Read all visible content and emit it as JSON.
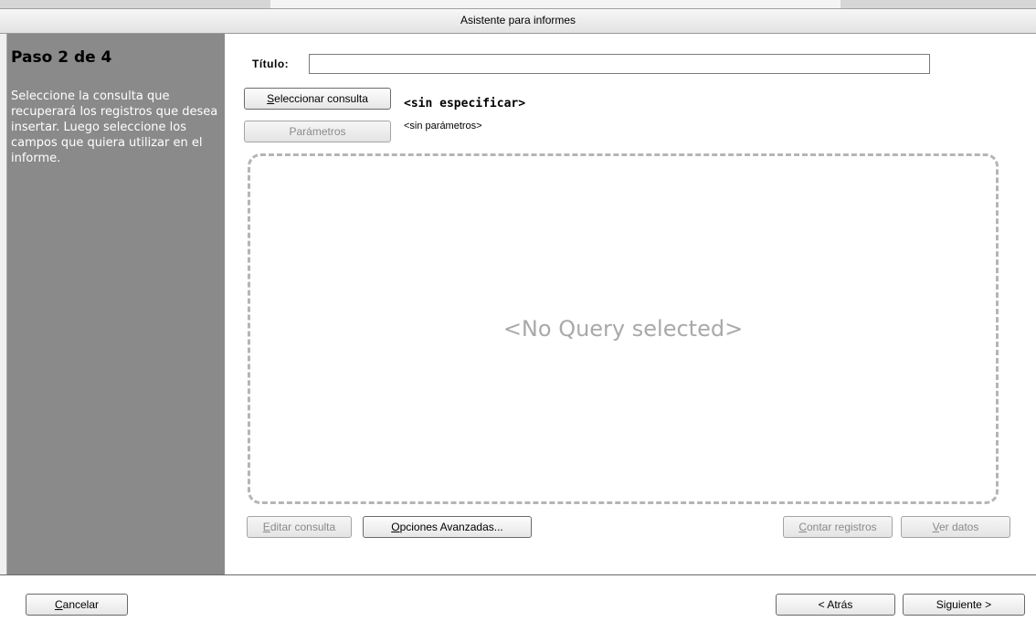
{
  "window": {
    "title": "Asistente para informes"
  },
  "sidebar": {
    "step": "Paso 2 de 4",
    "description": "Seleccione la consulta que recuperará los registros que desea insertar. Luego seleccione los campos que quiera utilizar en el informe."
  },
  "form": {
    "title_label": "Título:",
    "title_value": "",
    "select_query_button": {
      "mnemonic": "S",
      "rest": "eleccionar consulta"
    },
    "query_status": "<sin especificar>",
    "parameters_button": "Parámetros",
    "parameters_status": "<sin parámetros>",
    "query_placeholder": "<No Query selected>",
    "edit_query_button": {
      "mnemonic": "E",
      "rest": "ditar consulta"
    },
    "advanced_options_button": {
      "mnemonic": "O",
      "rest": "pciones Avanzadas..."
    },
    "count_records_button": {
      "mnemonic": "C",
      "rest": "ontar registros"
    },
    "view_data_button": {
      "mnemonic": "V",
      "rest": "er datos"
    }
  },
  "footer": {
    "cancel_button": {
      "mnemonic": "C",
      "rest": "ancelar"
    },
    "back_button": "< Atrás",
    "next_button": "Siguiente >"
  }
}
